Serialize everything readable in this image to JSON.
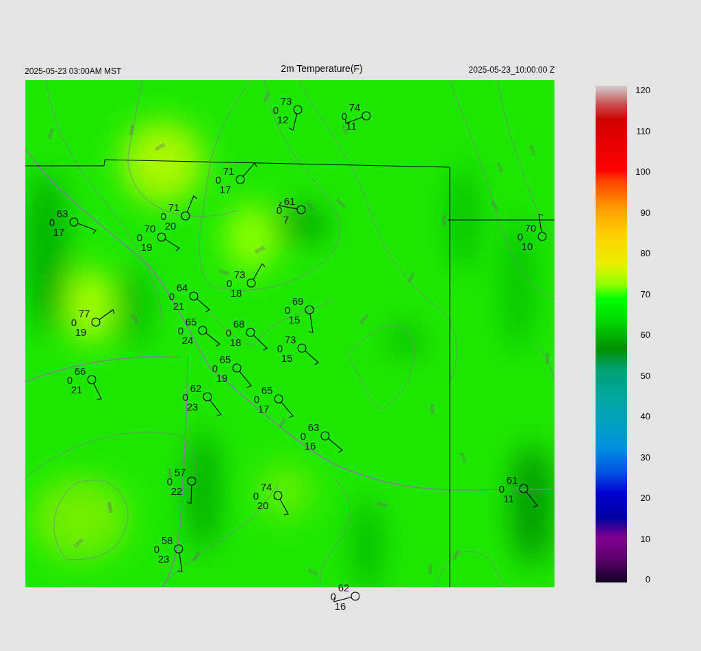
{
  "header": {
    "local_time": "2025-05-23 03:00AM MST",
    "title": "2m Temperature(F)",
    "valid_time": "2025-05-23_10:00:00 Z"
  },
  "map": {
    "contour_labels": [
      "2000",
      "3000",
      "4000",
      "4000",
      "4000",
      "3000",
      "6000",
      "3000",
      "7000",
      "5000",
      "5000",
      "4000",
      "5000",
      "6000",
      "4000",
      "4000",
      "5000",
      "4000",
      "4000",
      "3000",
      "4000",
      "5000",
      "3000",
      "4000",
      "5000",
      "5000",
      "6000",
      "3000"
    ],
    "stations": [
      {
        "temperature": "73",
        "left_value": "0",
        "dewpoint": "12"
      },
      {
        "temperature": "74",
        "left_value": "0",
        "dewpoint": "11"
      },
      {
        "temperature": "71",
        "left_value": "0",
        "dewpoint": "17"
      },
      {
        "temperature": "61",
        "left_value": "0",
        "dewpoint": "7"
      },
      {
        "temperature": "71",
        "left_value": "0",
        "dewpoint": "20"
      },
      {
        "temperature": "63",
        "left_value": "0",
        "dewpoint": "17"
      },
      {
        "temperature": "70",
        "left_value": "0",
        "dewpoint": "19"
      },
      {
        "temperature": "70",
        "left_value": "0",
        "dewpoint": "10"
      },
      {
        "temperature": "73",
        "left_value": "0",
        "dewpoint": "18"
      },
      {
        "temperature": "64",
        "left_value": "0",
        "dewpoint": "21"
      },
      {
        "temperature": "77",
        "left_value": "0",
        "dewpoint": "19"
      },
      {
        "temperature": "69",
        "left_value": "0",
        "dewpoint": "15"
      },
      {
        "temperature": "65",
        "left_value": "0",
        "dewpoint": "24"
      },
      {
        "temperature": "68",
        "left_value": "0",
        "dewpoint": "18"
      },
      {
        "temperature": "73",
        "left_value": "0",
        "dewpoint": "15"
      },
      {
        "temperature": "65",
        "left_value": "0",
        "dewpoint": "19"
      },
      {
        "temperature": "66",
        "left_value": "0",
        "dewpoint": "21"
      },
      {
        "temperature": "62",
        "left_value": "0",
        "dewpoint": "23"
      },
      {
        "temperature": "65",
        "left_value": "0",
        "dewpoint": "17"
      },
      {
        "temperature": "63",
        "left_value": "0",
        "dewpoint": "16"
      },
      {
        "temperature": "57",
        "left_value": "0",
        "dewpoint": "22"
      },
      {
        "temperature": "74",
        "left_value": "0",
        "dewpoint": "20"
      },
      {
        "temperature": "61",
        "left_value": "0",
        "dewpoint": "11"
      },
      {
        "temperature": "58",
        "left_value": "0",
        "dewpoint": "23"
      },
      {
        "temperature": "62",
        "left_value": "0",
        "dewpoint": "16"
      }
    ]
  },
  "colorbar": {
    "ticks": [
      "120",
      "110",
      "100",
      "90",
      "80",
      "70",
      "60",
      "50",
      "40",
      "30",
      "20",
      "10",
      "0"
    ]
  }
}
